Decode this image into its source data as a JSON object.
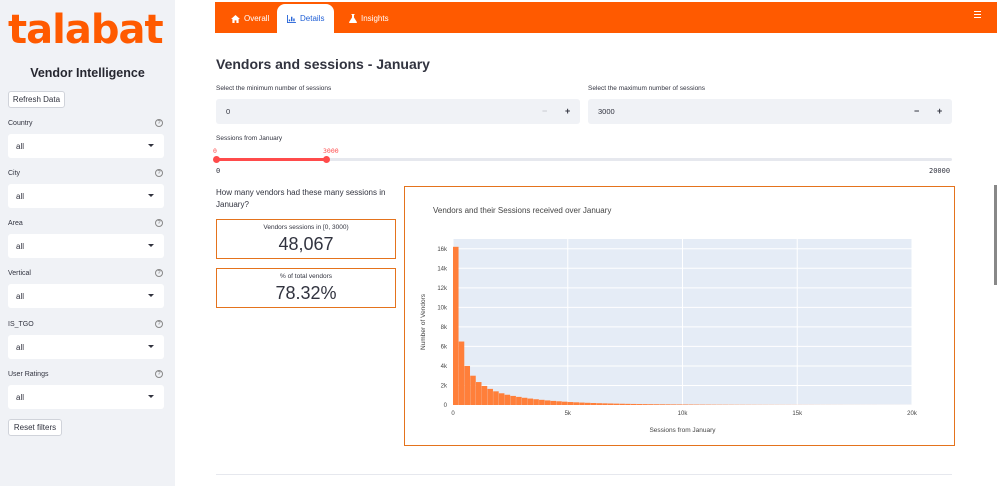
{
  "brand": {
    "logo_text": "talabat",
    "accent": "#ff5a00"
  },
  "sidebar": {
    "title": "Vendor Intelligence",
    "refresh_label": "Refresh Data",
    "filters": [
      {
        "label": "Country",
        "value": "all"
      },
      {
        "label": "City",
        "value": "all"
      },
      {
        "label": "Area",
        "value": "all"
      },
      {
        "label": "Vertical",
        "value": "all"
      },
      {
        "label": "IS_TGO",
        "value": "all"
      },
      {
        "label": "User Ratings",
        "value": "all"
      }
    ],
    "help_glyph": "?",
    "reset_label": "Reset filters"
  },
  "nav": {
    "tabs": [
      {
        "label": "Overall",
        "icon": "home-icon"
      },
      {
        "label": "Details",
        "icon": "bar-chart-icon"
      },
      {
        "label": "Insights",
        "icon": "flask-icon"
      }
    ],
    "active": "Details"
  },
  "main": {
    "title": "Vendors and sessions - January",
    "min_label": "Select the minimum number of sessions",
    "min_value": "0",
    "max_label": "Select the maximum number of sessions",
    "max_value": "3000",
    "minus": "−",
    "plus": "+",
    "slider_label": "Sessions from January",
    "slider_low": "0",
    "slider_high": "3000",
    "slider_min": "0",
    "slider_max": "20000",
    "question": "How many vendors had these many sessions in January?",
    "metric1_label": "Vendors sessions in [0, 3000)",
    "metric1_value": "48,067",
    "metric2_label": "% of total vendors",
    "metric2_value": "78.32%"
  },
  "chart_data": {
    "type": "bar",
    "title": "Vendors and their Sessions received over January",
    "xlabel": "Sessions from January",
    "ylabel": "Number of Vendors",
    "xlim": [
      0,
      20000
    ],
    "ylim": [
      0,
      17000
    ],
    "xticks": [
      "0",
      "5k",
      "10k",
      "15k",
      "20k"
    ],
    "yticks": [
      "0",
      "2k",
      "4k",
      "6k",
      "8k",
      "10k",
      "12k",
      "14k",
      "16k"
    ],
    "bin_width": 250,
    "color": "#ff7f3a",
    "values": [
      16200,
      6500,
      4000,
      3000,
      2350,
      1950,
      1650,
      1400,
      1200,
      1050,
      930,
      830,
      740,
      660,
      590,
      530,
      470,
      420,
      380,
      340,
      305,
      275,
      250,
      225,
      205,
      185,
      170,
      155,
      140,
      128,
      117,
      107,
      98,
      90,
      83,
      76,
      70,
      64,
      59,
      54,
      50,
      46,
      42,
      39,
      36,
      33,
      30,
      28,
      26,
      24,
      22,
      20,
      19,
      17,
      16,
      15,
      14,
      13,
      12,
      11,
      10,
      9,
      9,
      8,
      7,
      7,
      6,
      6,
      5,
      5,
      5,
      4,
      4,
      4,
      3,
      3,
      3,
      3,
      2,
      2
    ]
  }
}
